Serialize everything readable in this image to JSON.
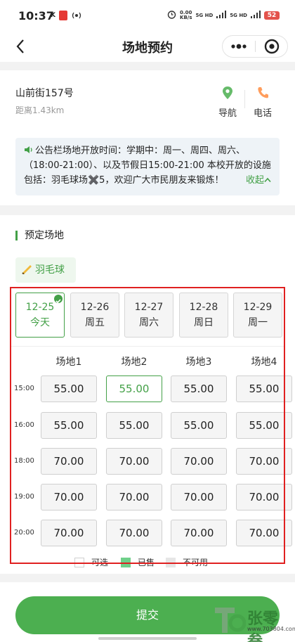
{
  "status_bar": {
    "time": "10:37",
    "carrier_mark": "K",
    "net_speed": "0.00\nKB/s",
    "signal1": "5G HD",
    "signal2": "5G HD",
    "battery": "52"
  },
  "nav": {
    "title": "场地预约",
    "back_icon": "chevron-left-icon",
    "more_icon": "more-dots-icon",
    "close_icon": "target-close-icon"
  },
  "venue": {
    "address": "山前街157号",
    "distance": "距离1.43km",
    "navigate_label": "导航",
    "phone_label": "电话",
    "accent_color": "#43a047"
  },
  "notice": {
    "text": "公告栏场地开放时间：学期中：周一、周四、周六、（18:00-21:00）、以及节假日15:00-21:00 本校开放的设施包括：羽毛球场✖️5，欢迎广大市民朋友来锻炼！",
    "collapse_label": "收起"
  },
  "booking": {
    "section_title": "预定场地",
    "sport": "羽毛球",
    "dates": [
      {
        "date": "12-25",
        "day": "今天",
        "active": true
      },
      {
        "date": "12-26",
        "day": "周五",
        "active": false
      },
      {
        "date": "12-27",
        "day": "周六",
        "active": false
      },
      {
        "date": "12-28",
        "day": "周日",
        "active": false
      },
      {
        "date": "12-29",
        "day": "周一",
        "active": false
      }
    ],
    "courts": [
      "场地1",
      "场地2",
      "场地3",
      "场地4"
    ],
    "rows": [
      {
        "time": "15:00",
        "prices": [
          "55.00",
          "55.00",
          "55.00",
          "55.00"
        ]
      },
      {
        "time": "16:00",
        "prices": [
          "55.00",
          "55.00",
          "55.00",
          "55.00"
        ]
      },
      {
        "time": "18:00",
        "prices": [
          "70.00",
          "70.00",
          "70.00",
          "70.00"
        ]
      },
      {
        "time": "19:00",
        "prices": [
          "70.00",
          "70.00",
          "70.00",
          "70.00"
        ]
      },
      {
        "time": "20:00",
        "prices": [
          "70.00",
          "70.00",
          "70.00",
          "70.00"
        ]
      }
    ],
    "selected_slot": {
      "row": 0,
      "court": 1
    },
    "legend": [
      {
        "label": "可选",
        "color": "#ffffff"
      },
      {
        "label": "已售",
        "color": "#6fd08a"
      },
      {
        "label": "不可用",
        "color": "#e6e6e6"
      }
    ]
  },
  "submit_label": "提交",
  "watermark": {
    "brand": "张零叁",
    "url": "www.703804.com"
  }
}
